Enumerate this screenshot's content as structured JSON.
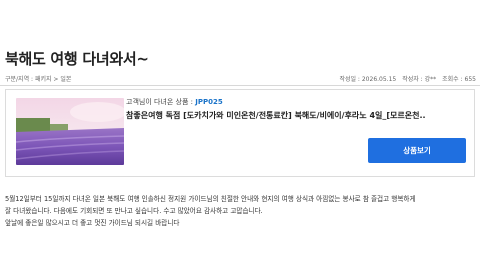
{
  "page": {
    "title": "북해도 여행 다녀와서~"
  },
  "meta": {
    "category": "구분/지역 : 패키지 > 일본",
    "date": "작성일 : 2026.05.15",
    "author": "작성자 : 강**",
    "views": "조회수 : 655"
  },
  "product": {
    "guide_prefix": "고객님이 다녀온 상품 : ",
    "code": "JPP025",
    "name": "참좋은여행 독점 [도카치가와 미인온천/전통료칸] 북해도/비에이/후라노 4일_[모르온천..",
    "button_label": "상품보기",
    "thumbnail": "lavender-field-photo"
  },
  "content": {
    "lines": [
      "5월12일부터 15일까지 다녀온 일본 북해도 여행 인솔하신 정지원 가이드님의 친절한 안내와 현지의 여행 상식과 아낌없는 봉사로 참 즐겁고 행복하게",
      "잘 다녀왔습니다. 다음에도 기회되면 또 만나고 싶습니다. 수고 많았어요 감사하고 고맙습니다.",
      "앞날에 좋은일 많으시고 더 좋고 멋진 가이드님 되시길 바랍니다"
    ]
  },
  "colors": {
    "accent": "#1f6fe0",
    "code": "#1a73c9"
  }
}
